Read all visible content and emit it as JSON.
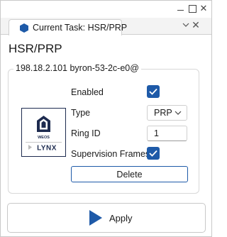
{
  "window": {
    "controls": [
      "minimize-icon",
      "maximize-icon",
      "close-icon"
    ],
    "close_glyph": "✕"
  },
  "tab": {
    "label": "Current Task: HSR/PRP",
    "icon": "hexagon-icon",
    "chevron_glyph": "⌵",
    "close_glyph": "✕"
  },
  "page": {
    "title": "HSR/PRP"
  },
  "device": {
    "legend": "198.18.2.101 byron-53-2c-e0@",
    "logo": {
      "brand_top": "WEOS",
      "brand_bottom": "LYNX"
    }
  },
  "form": {
    "enabled_label": "Enabled",
    "enabled_checked": true,
    "type_label": "Type",
    "type_value": "PRP",
    "ring_id_label": "Ring ID",
    "ring_id_value": "1",
    "supervision_label": "Supervision Frames",
    "supervision_checked": true,
    "delete_label": "Delete"
  },
  "footer": {
    "apply_label": "Apply",
    "apply_icon": "play-icon"
  },
  "colors": {
    "accent": "#1e5aa8",
    "logo_navy": "#1d2b4f",
    "border": "#d8d8d8"
  }
}
